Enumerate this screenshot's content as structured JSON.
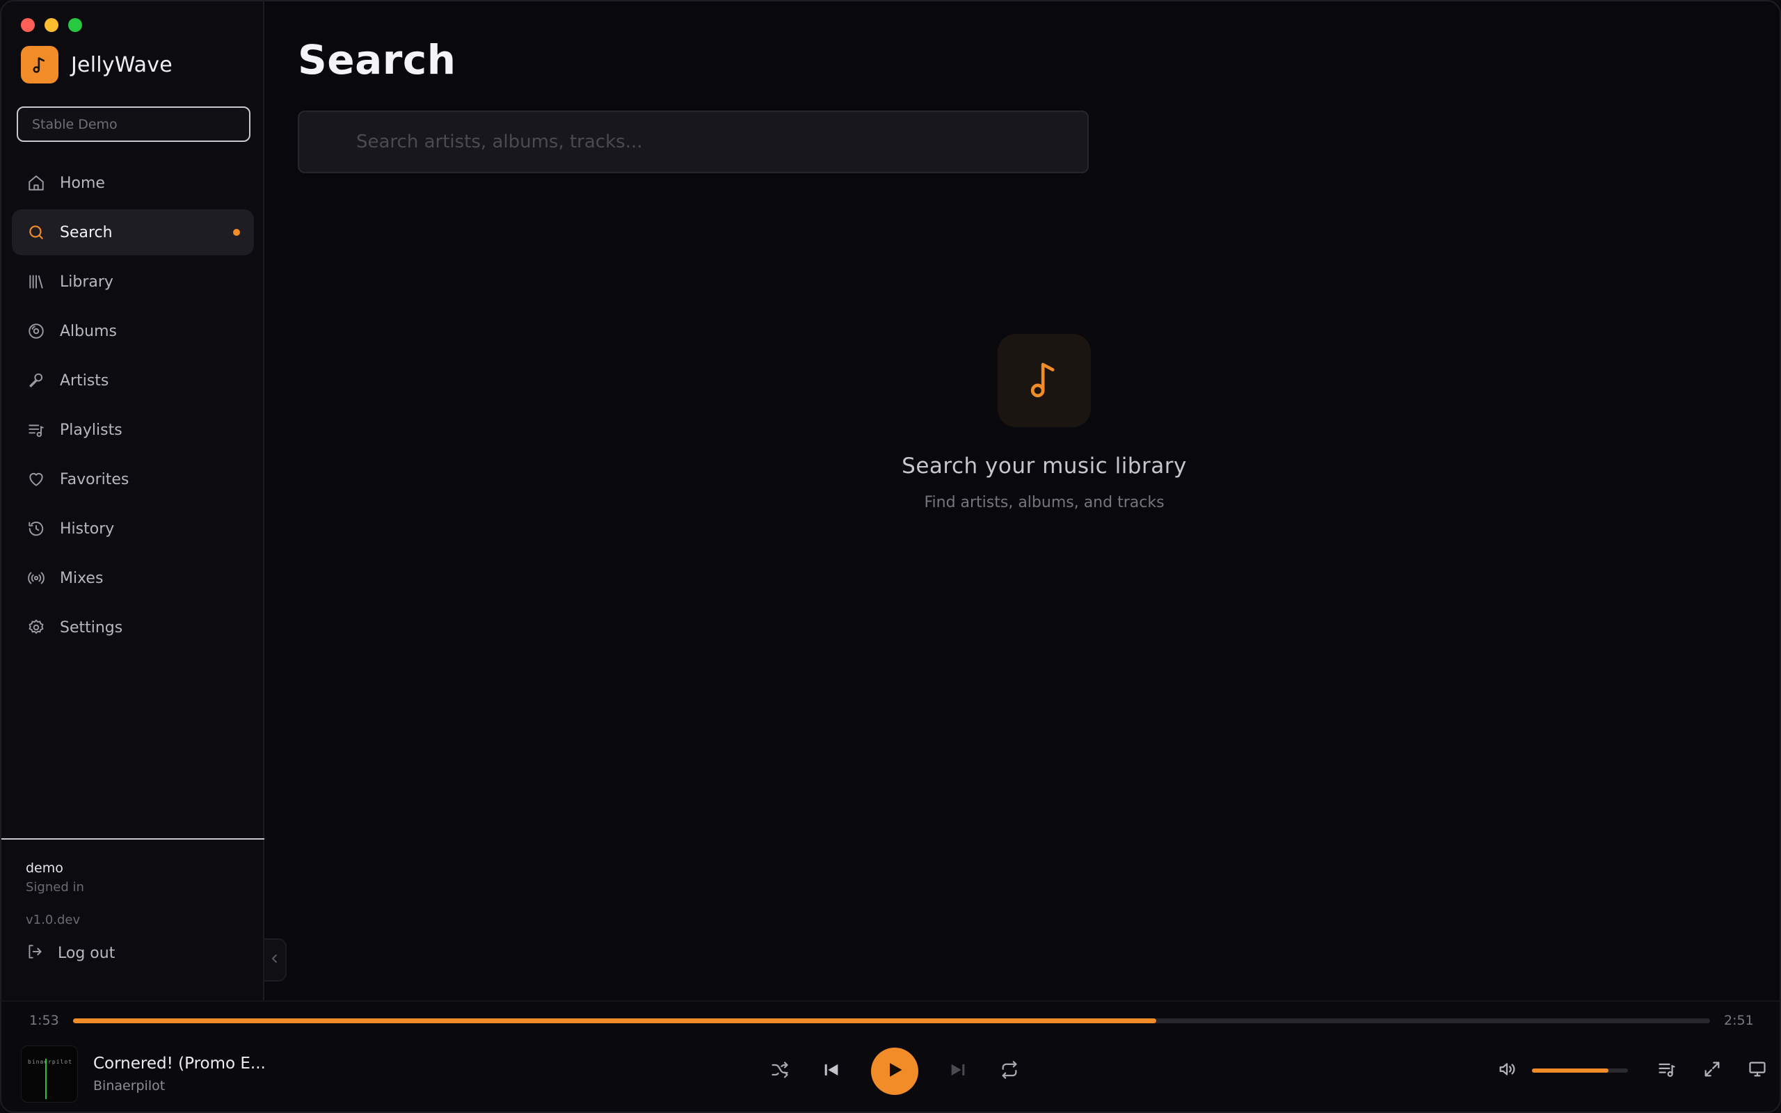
{
  "app": {
    "name": "JellyWave",
    "accent": "#f28c28"
  },
  "sidebar": {
    "server_placeholder": "Stable Demo",
    "items": [
      {
        "label": "Home",
        "icon": "home-icon"
      },
      {
        "label": "Search",
        "icon": "search-icon",
        "active": true
      },
      {
        "label": "Library",
        "icon": "library-icon"
      },
      {
        "label": "Albums",
        "icon": "disc-icon"
      },
      {
        "label": "Artists",
        "icon": "microphone-icon"
      },
      {
        "label": "Playlists",
        "icon": "playlist-icon"
      },
      {
        "label": "Favorites",
        "icon": "heart-icon"
      },
      {
        "label": "History",
        "icon": "history-icon"
      },
      {
        "label": "Mixes",
        "icon": "radio-icon"
      },
      {
        "label": "Settings",
        "icon": "gear-icon"
      }
    ],
    "user": {
      "name": "demo",
      "status": "Signed in"
    },
    "version": "v1.0.dev",
    "logout_label": "Log out"
  },
  "main": {
    "title": "Search",
    "search_placeholder": "Search artists, albums, tracks...",
    "empty_title": "Search your music library",
    "empty_subtitle": "Find artists, albums, and tracks"
  },
  "player": {
    "current_time": "1:53",
    "total_time": "2:51",
    "progress_fraction": 0.6615,
    "track_title": "Cornered! (Promo E...",
    "track_artist": "Binaerpilot",
    "cover_text": "binaerpilot",
    "volume_fraction": 0.8
  }
}
